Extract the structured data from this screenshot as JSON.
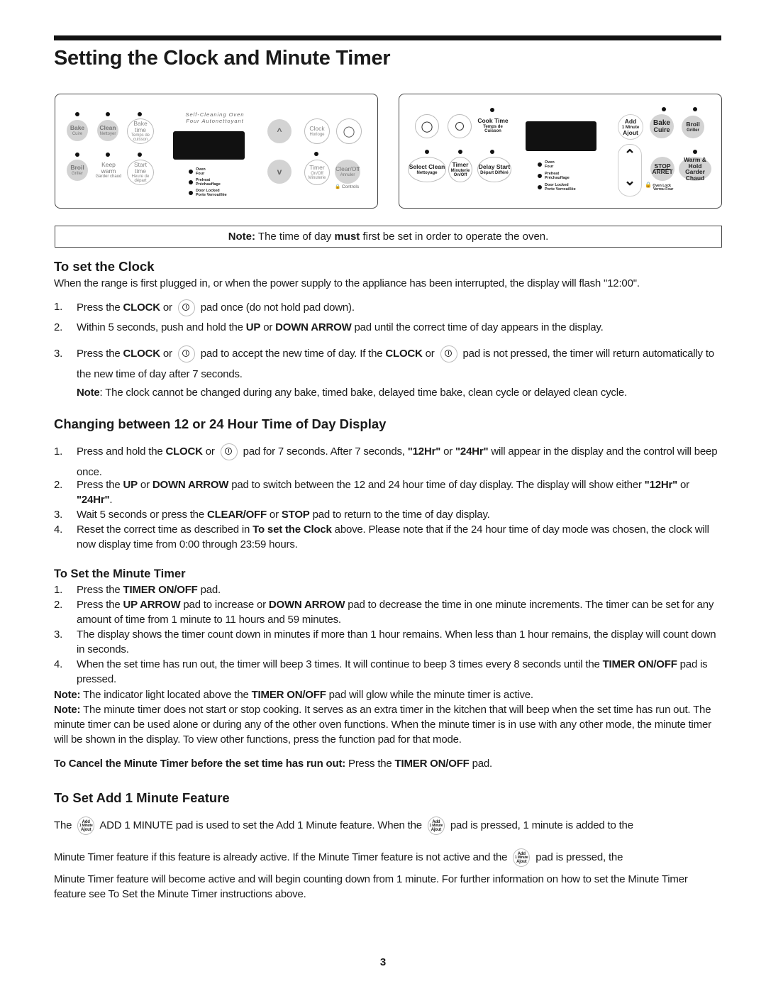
{
  "page": {
    "title": "Setting the Clock and Minute Timer",
    "page_number": "3"
  },
  "panel_left": {
    "banner": [
      "Self-Cleaning Oven",
      "Four Autonettoyant"
    ],
    "pads": {
      "bake": [
        "Bake",
        "Cuire"
      ],
      "clean": [
        "Clean",
        "Nettoyer"
      ],
      "bake_time": [
        "Bake time",
        "Temps de cuisson"
      ],
      "broil": [
        "Broil",
        "Griller"
      ],
      "keep_warm": [
        "Keep warm",
        "Garder chaud"
      ],
      "start_time": [
        "Start time",
        "Heure de départ"
      ],
      "clock": [
        "Clock",
        "Horloge"
      ],
      "timer": [
        "Timer",
        "On/Off Minuterie"
      ],
      "clear_off": [
        "Clear/Off",
        "Annuler"
      ],
      "up": "^",
      "down": "v"
    },
    "indicators": [
      [
        "Oven",
        "Four"
      ],
      [
        "Preheat",
        "Préchauffage"
      ],
      [
        "Door Locked",
        "Porte Verrouillée"
      ]
    ],
    "controls_lock": "Controls"
  },
  "panel_right": {
    "pads": {
      "cook_time": [
        "Cook Time",
        "Temps de Cuisson"
      ],
      "select_clean": [
        "Select Clean",
        "Nettoyage"
      ],
      "timer": [
        "Timer",
        "Minuterie On/Off"
      ],
      "delay_start": [
        "Delay Start",
        "Départ Différé"
      ],
      "add_minute": [
        "Add",
        "1 Minute",
        "Ajout"
      ],
      "bake": [
        "Bake",
        "Cuire"
      ],
      "broil": [
        "Broil",
        "Griller"
      ],
      "stop": [
        "STOP",
        "ARRÊT"
      ],
      "warm_hold": [
        "Warm & Hold",
        "Garder Chaud"
      ]
    },
    "indicators": [
      [
        "Oven",
        "Four"
      ],
      [
        "Preheat",
        "Préchauffage"
      ],
      [
        "Door Locked",
        "Porte Verrouillée"
      ]
    ],
    "oven_lock": [
      "Oven Lock",
      "Verrou Four"
    ]
  },
  "note_box": {
    "label": "Note:",
    "pre": " The time of day ",
    "bold": "must",
    "post": " first be set in order to operate the oven."
  },
  "set_clock": {
    "heading": "To set the Clock",
    "intro": "When the range is first plugged in, or when the power supply to the appliance has been interrupted, the display will flash \"12:00\".",
    "steps": [
      {
        "n": "1.",
        "a": "Press the ",
        "b1": "CLOCK",
        "c": " or ",
        "d": " pad once (do not hold pad down)."
      },
      {
        "n": "2.",
        "a": "Within 5 seconds, push and hold the ",
        "b1": "UP",
        "c": " or ",
        "b2": "DOWN ARROW",
        "d": " pad until the correct time of day appears in the display."
      },
      {
        "n": "3.",
        "a": "Press the ",
        "b1": "CLOCK",
        "c": " or ",
        "d": " pad to accept the new time of day. If the ",
        "b2": "CLOCK",
        "e": " or ",
        "f": " pad is not pressed, the timer will return automatically to the new time of day after 7 seconds."
      }
    ],
    "note_label": "Note",
    "note_text": ": The clock cannot be changed during any bake, timed bake, delayed time bake, clean cycle or delayed clean cycle."
  },
  "hour_display": {
    "heading": "Changing between 12 or 24 Hour Time of Day Display",
    "steps": [
      {
        "n": "1.",
        "a": "Press and hold the ",
        "b1": "CLOCK",
        "c": " or ",
        "d": " pad for 7 seconds. After 7 seconds, ",
        "b2": "\"12Hr\"",
        "e": " or ",
        "b3": "\"24Hr\"",
        "f": " will appear in the display and the control will beep once."
      },
      {
        "n": "2.",
        "a": "Press the ",
        "b1": "UP",
        "c": " or ",
        "b2": "DOWN ARROW",
        "d": " pad to switch between the 12 and 24 hour time of day display. The display will show either ",
        "b3": "\"12Hr\"",
        "e": " or ",
        "b4": "\"24Hr\"",
        "f": "."
      },
      {
        "n": "3.",
        "a": "Wait 5 seconds or press the ",
        "b1": "CLEAR/OFF",
        "c": " or ",
        "b2": "STOP",
        "d": " pad to return to the time of day display."
      },
      {
        "n": "4.",
        "a": "Reset the correct time as described in ",
        "b1": "To set the Clock",
        "c": " above. Please note that if the 24 hour time of day mode was chosen, the clock will now display time from 0:00 through 23:59 hours."
      }
    ]
  },
  "minute_timer": {
    "heading": "To Set the Minute Timer",
    "steps": [
      {
        "n": "1.",
        "a": "Press the ",
        "b1": "TIMER ON/OFF",
        "c": " pad."
      },
      {
        "n": "2.",
        "a": "Press the ",
        "b1": "UP ARROW",
        "c": " pad to increase or ",
        "b2": "DOWN ARROW",
        "d": " pad to decrease the time in one minute increments. The timer can be set for any amount of time from 1 minute to 11 hours and 59 minutes."
      },
      {
        "n": "3.",
        "a": "The display shows the timer count down in minutes if more than 1 hour remains. When less than 1 hour remains, the display will count down in seconds."
      },
      {
        "n": "4.",
        "a": "When the set time has run out, the timer will beep 3 times. It will continue to beep 3 times every 8 seconds until the ",
        "b1": "TIMER ON/OFF",
        "c": " pad is pressed."
      }
    ],
    "note1_label": "Note:",
    "note1_a": " The indicator light located above the ",
    "note1_b": "TIMER ON/OFF",
    "note1_c": " pad will glow while the minute timer is active.",
    "note2_label": "Note:",
    "note2_text": " The minute timer does not start or stop cooking. It serves as an extra timer in the kitchen that will beep when the set time has run out. The minute timer can be used alone or during any of the other oven functions. When the minute timer is in use with any other mode, the minute timer will be shown in the display. To view other functions, press the function pad for that mode.",
    "cancel_bold": "To Cancel the Minute Timer before the set time has run out:",
    "cancel_a": " Press the ",
    "cancel_b": "TIMER ON/OFF",
    "cancel_c": " pad."
  },
  "add_minute": {
    "heading": "To Set Add 1 Minute Feature",
    "l1a": "The ",
    "l1b": " ADD 1 MINUTE pad is used to set the Add 1 Minute feature. When the ",
    "l1c": " pad is pressed, 1 minute is added to the",
    "l2a": "Minute Timer feature if this feature is already active. If the Minute Timer feature is not active and the ",
    "l2b": " pad is pressed, the",
    "l3": "Minute Timer feature will become active and will begin counting down from 1 minute. For further information on how to set the Minute Timer feature see To Set the Minute Timer instructions above.",
    "icon": [
      "Add",
      "1 Minute",
      "Ajout"
    ]
  }
}
